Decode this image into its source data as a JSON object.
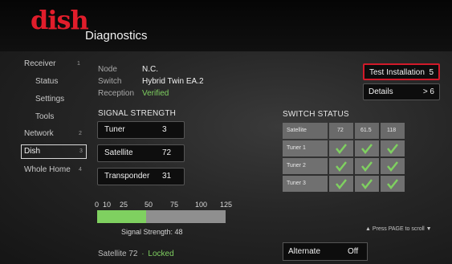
{
  "header": {
    "brand": "dish",
    "title": "Diagnostics"
  },
  "sidebar": {
    "items": [
      {
        "label": "Receiver",
        "num": "1"
      },
      {
        "label": "Status"
      },
      {
        "label": "Settings"
      },
      {
        "label": "Tools"
      },
      {
        "label": "Network",
        "num": "2"
      },
      {
        "label": "Dish",
        "num": "3"
      },
      {
        "label": "Whole Home",
        "num": "4"
      }
    ]
  },
  "info": {
    "node_label": "Node",
    "node_value": "N.C.",
    "switch_label": "Switch",
    "switch_value": "Hybrid Twin EA.2",
    "reception_label": "Reception",
    "reception_value": "Verified"
  },
  "signal": {
    "title": "SIGNAL STRENGTH",
    "tuner_label": "Tuner",
    "tuner_value": "3",
    "satellite_label": "Satellite",
    "satellite_value": "72",
    "transponder_label": "Transponder",
    "transponder_value": "31",
    "scale": [
      "0",
      "10",
      "25",
      "50",
      "75",
      "100",
      "125"
    ],
    "strength_fraction": 0.384,
    "strength_label": "Signal Strength: 48",
    "status_prefix": "Satellite 72",
    "status_sep": "·",
    "status_value": "Locked"
  },
  "actions": {
    "test_label": "Test Installation",
    "test_key": "5",
    "details_label": "Details",
    "details_key": "> 6"
  },
  "switch_status": {
    "title": "SWITCH STATUS",
    "headers": [
      "Satellite",
      "72",
      "61.5",
      "118"
    ],
    "rows": [
      "Tuner 1",
      "Tuner 2",
      "Tuner 3"
    ]
  },
  "scroll_hint": "▲ Press PAGE to scroll ▼",
  "alternate": {
    "label": "Alternate",
    "value": "Off"
  },
  "colors": {
    "brand": "#e11d2b",
    "accent_green": "#7fd060",
    "focus_red": "#d11a2a"
  },
  "icons": {
    "check": "check-icon"
  }
}
